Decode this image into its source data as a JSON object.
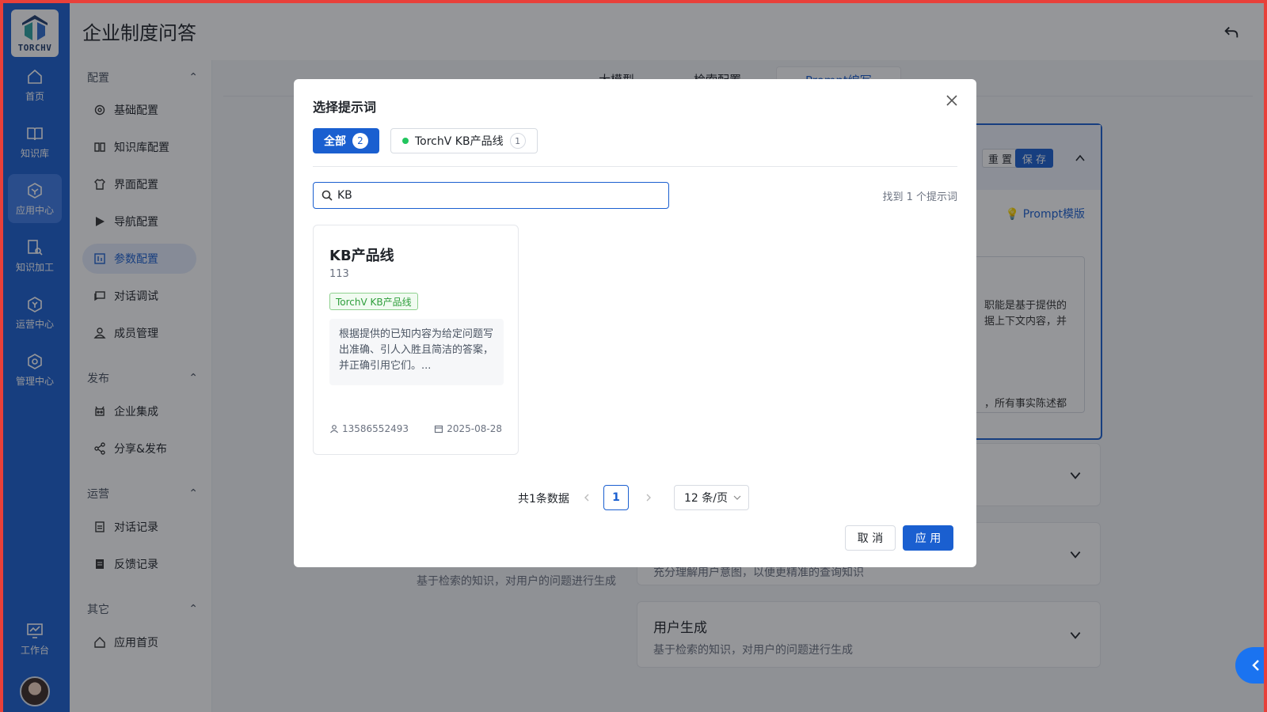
{
  "brand": {
    "logo_text": "TORCHV"
  },
  "rail": [
    {
      "label": "首页",
      "icon": "home-icon"
    },
    {
      "label": "知识库",
      "icon": "book-icon"
    },
    {
      "label": "应用中心",
      "icon": "app-center-icon",
      "active": true
    },
    {
      "label": "知识加工",
      "icon": "knowledge-process-icon"
    },
    {
      "label": "运营中心",
      "icon": "operation-icon"
    },
    {
      "label": "管理中心",
      "icon": "admin-icon"
    },
    {
      "label": "工作台",
      "icon": "workbench-icon"
    }
  ],
  "page": {
    "title": "企业制度问答"
  },
  "sidenav": {
    "groups": [
      {
        "label": "配置",
        "items": [
          "基础配置",
          "知识库配置",
          "界面配置",
          "导航配置",
          "参数配置",
          "对话调试",
          "成员管理"
        ]
      },
      {
        "label": "发布",
        "items": [
          "企业集成",
          "分享&发布"
        ]
      },
      {
        "label": "运营",
        "items": [
          "对话记录",
          "反馈记录"
        ]
      },
      {
        "label": "其它",
        "items": [
          "应用首页"
        ]
      }
    ],
    "active_item": "参数配置"
  },
  "main": {
    "tabs": [
      "大模型",
      "检索配置",
      "Prompt编写"
    ],
    "panel": {
      "reset_label": "重 置",
      "save_label": "保 存",
      "prompt_template_label": "Prompt模版",
      "editor_line1": "职能是基于提供的",
      "editor_line2": "据上下文内容，并",
      "editor_line3": "，所有事实陈述都"
    },
    "accordion2_desc": "充分理解用户意图，以便更精准的查询知识",
    "accordion3_title": "用户生成",
    "accordion3_desc": "基于检索的知识，对用户的问题进行生成",
    "left_desc": "基于检索的知识，对用户的问题进行生成"
  },
  "modal": {
    "title": "选择提示词",
    "filters": [
      {
        "label": "全部",
        "count": "2",
        "active": true
      },
      {
        "label": "TorchV KB产品线",
        "count": "1",
        "active": false
      }
    ],
    "search_value": "KB",
    "found_text": "找到 1 个提示词",
    "cards": [
      {
        "title": "KB产品线",
        "subtitle": "113",
        "tag": "TorchV KB产品线",
        "desc": "根据提供的已知内容为给定问题写出准确、引人入胜且简洁的答案，并正确引用它们。...",
        "user": "13586552493",
        "date": "2025-08-28"
      }
    ],
    "pager": {
      "total": "共1条数据",
      "current": "1",
      "page_size": "12 条/页"
    },
    "cancel_label": "取 消",
    "apply_label": "应 用"
  },
  "colors": {
    "primary": "#1a5fd0",
    "rail": "#1a5fd0",
    "success": "#22c55e",
    "frame": "#e8403a"
  }
}
